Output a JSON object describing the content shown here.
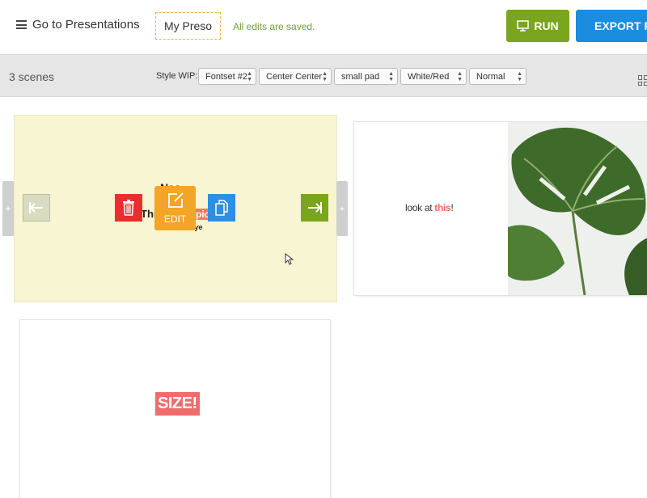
{
  "header": {
    "back_label": "Go to Presentations",
    "title": "My Preso",
    "save_status": "All edits are saved.",
    "run_label": "RUN",
    "export_label": "EXPORT PDF"
  },
  "toolbar": {
    "scene_count": "3 scenes",
    "style_label": "Style WIP:",
    "selects": [
      {
        "value": "Fontset #2"
      },
      {
        "value": "Center Center"
      },
      {
        "value": "small pad"
      },
      {
        "value": "White/Red"
      },
      {
        "value": "Normal"
      }
    ]
  },
  "scenes": [
    {
      "text_top": "Nas",
      "text_main": "This",
      "text_highlight": "pic",
      "text_bottom": "than ye",
      "edit_label": "EDIT",
      "add_left": "+",
      "add_right": "+"
    },
    {
      "text_prefix": "look at ",
      "text_accent": "this",
      "text_suffix": "!"
    },
    {
      "badge": "SIZE!"
    }
  ],
  "colors": {
    "run": "#7aa51e",
    "export": "#1a8de0",
    "delete": "#ec2d2d",
    "edit": "#f3a528",
    "copy": "#2d8fe3",
    "accent_red": "#f06b5a",
    "selected_scene_bg": "#f7f5d2"
  }
}
